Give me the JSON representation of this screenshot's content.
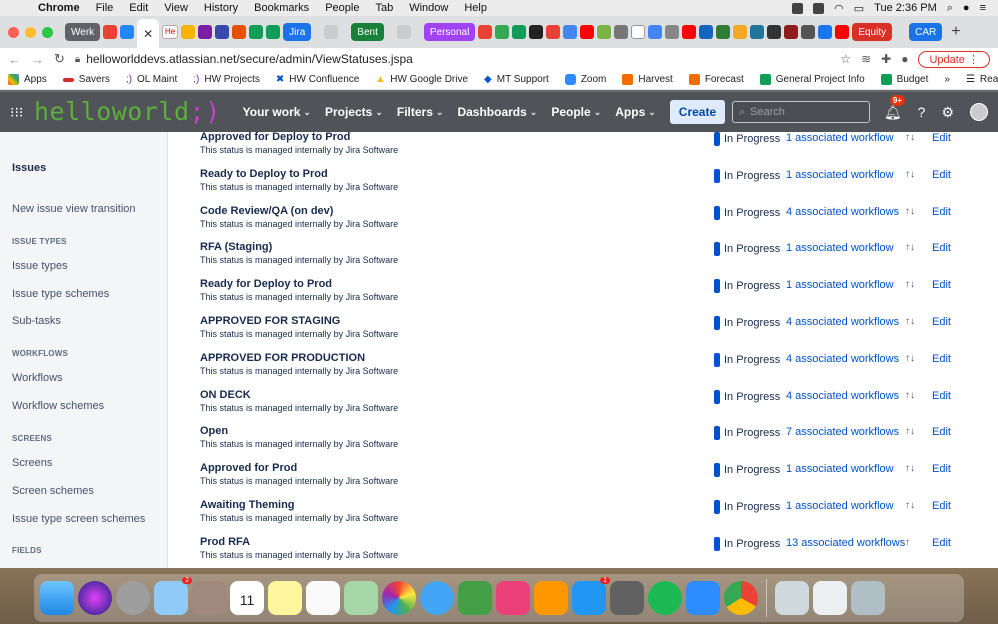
{
  "menubar": {
    "items": [
      "Chrome",
      "File",
      "Edit",
      "View",
      "History",
      "Bookmarks",
      "People",
      "Tab",
      "Window",
      "Help"
    ],
    "clock": "Tue 2:36 PM"
  },
  "tabstrip": {
    "groups": [
      {
        "label": "Werk",
        "color": "#5f6368"
      },
      {
        "label": "Jira",
        "color": "#1a73e8"
      },
      {
        "label": "Bent",
        "color": "#188038"
      },
      {
        "label": "Personal",
        "color": "#a142f4"
      },
      {
        "label": "Equity",
        "color": "#d93025"
      },
      {
        "label": "CAR",
        "color": "#1a73e8"
      }
    ],
    "partial_tab": "He",
    "new_tab": "+"
  },
  "toolbar": {
    "url": "helloworlddevs.atlassian.net/secure/admin/ViewStatuses.jspa",
    "update_label": "Update"
  },
  "bookmarks": {
    "items": [
      "Apps",
      "Savers",
      "OL Maint",
      "HW Projects",
      "HW Confluence",
      "HW Google Drive",
      "MT Support",
      "Zoom",
      "Harvest",
      "Forecast",
      "General Project Info",
      "Budget"
    ],
    "more": "»",
    "reading_list": "Reading List"
  },
  "jira_nav": {
    "logo_text": "helloworld",
    "logo_suffix": ";)",
    "items": [
      "Your work",
      "Projects",
      "Filters",
      "Dashboards",
      "People",
      "Apps"
    ],
    "create_label": "Create",
    "search_placeholder": "Search",
    "notif_badge": "9+"
  },
  "sidebar": {
    "items": [
      {
        "label": "Issues",
        "active": true
      },
      {
        "label": "New issue view transition"
      },
      {
        "label": "ISSUE TYPES",
        "heading": true
      },
      {
        "label": "Issue types"
      },
      {
        "label": "Issue type schemes"
      },
      {
        "label": "Sub-tasks"
      },
      {
        "label": "WORKFLOWS",
        "heading": true
      },
      {
        "label": "Workflows"
      },
      {
        "label": "Workflow schemes"
      },
      {
        "label": "SCREENS",
        "heading": true
      },
      {
        "label": "Screens"
      },
      {
        "label": "Screen schemes"
      },
      {
        "label": "Issue type screen schemes"
      },
      {
        "label": "FIELDS",
        "heading": true
      }
    ]
  },
  "statuses": {
    "category_color": "#0052cc",
    "edit_label": "Edit",
    "rows": [
      {
        "name": "Approved for Deploy to Prod",
        "desc": "This status is managed internally by Jira Software",
        "category": "In Progress",
        "workflows": "1 associated workflow",
        "arrows": "↑↓"
      },
      {
        "name": "Ready to Deploy to Prod",
        "desc": "This status is managed internally by Jira Software",
        "category": "In Progress",
        "workflows": "1 associated workflow",
        "arrows": "↑↓"
      },
      {
        "name": "Code Review/QA (on dev)",
        "desc": "This status is managed internally by Jira Software",
        "category": "In Progress",
        "workflows": "4 associated workflows",
        "arrows": "↑↓"
      },
      {
        "name": "RFA (Staging)",
        "desc": "This status is managed internally by Jira Software",
        "category": "In Progress",
        "workflows": "1 associated workflow",
        "arrows": "↑↓"
      },
      {
        "name": "Ready for Deploy to Prod",
        "desc": "This status is managed internally by Jira Software",
        "category": "In Progress",
        "workflows": "1 associated workflow",
        "arrows": "↑↓"
      },
      {
        "name": "APPROVED FOR STAGING",
        "desc": "This status is managed internally by Jira Software",
        "category": "In Progress",
        "workflows": "4 associated workflows",
        "arrows": "↑↓"
      },
      {
        "name": "APPROVED FOR PRODUCTION",
        "desc": "This status is managed internally by Jira Software",
        "category": "In Progress",
        "workflows": "4 associated workflows",
        "arrows": "↑↓"
      },
      {
        "name": "ON DECK",
        "desc": "This status is managed internally by Jira Software",
        "category": "In Progress",
        "workflows": "4 associated workflows",
        "arrows": "↑↓"
      },
      {
        "name": "Open",
        "desc": "This status is managed internally by Jira Software",
        "category": "In Progress",
        "workflows": "7 associated workflows",
        "arrows": "↑↓"
      },
      {
        "name": "Approved for Prod",
        "desc": "This status is managed internally by Jira Software",
        "category": "In Progress",
        "workflows": "1 associated workflow",
        "arrows": "↑↓"
      },
      {
        "name": "Awaiting Theming",
        "desc": "This status is managed internally by Jira Software",
        "category": "In Progress",
        "workflows": "1 associated workflow",
        "arrows": "↑↓"
      },
      {
        "name": "Prod RFA",
        "desc": "This status is managed internally by Jira Software",
        "category": "In Progress",
        "workflows": "13 associated workflows",
        "arrows": "↑"
      }
    ]
  },
  "dock": {
    "mail_badge": "2",
    "appstore_badge": "1",
    "calendar_day": "11",
    "calendar_month": "MAY"
  }
}
